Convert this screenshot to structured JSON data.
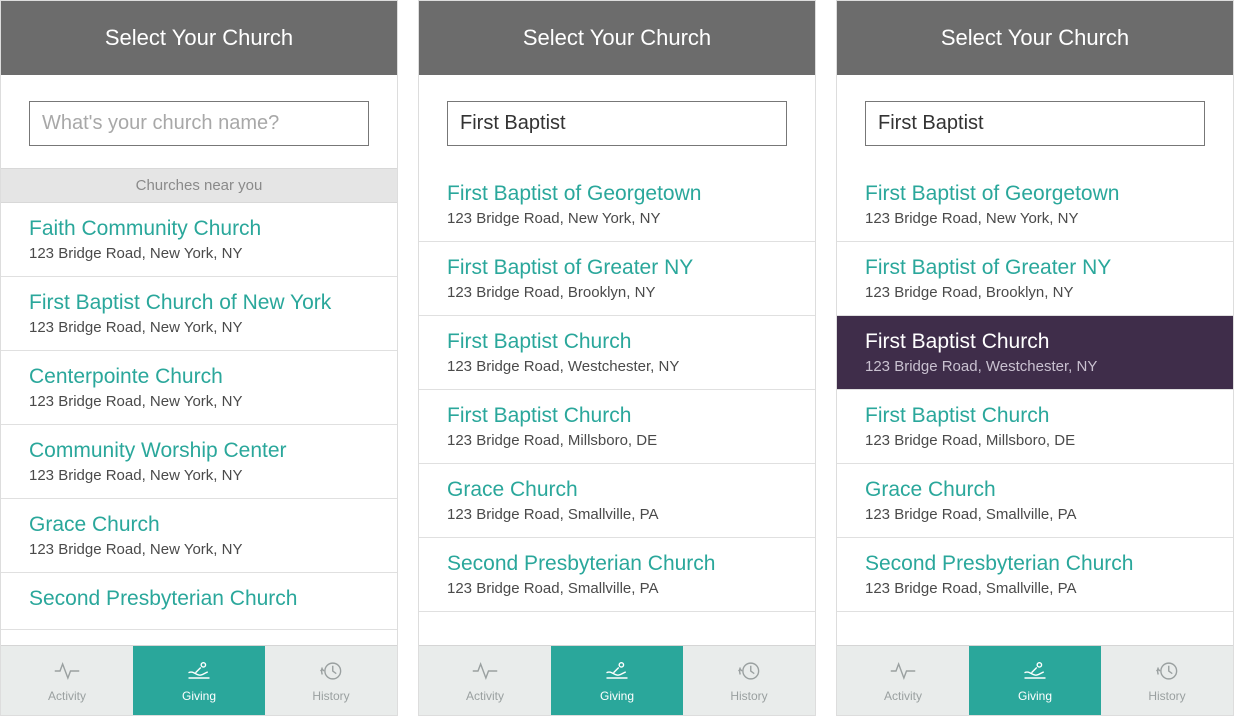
{
  "header_title": "Select Your Church",
  "search_placeholder": "What's your church name?",
  "section_near_label": "Churches near you",
  "colors": {
    "accent": "#2aa79b",
    "header": "#6c6c6c",
    "selected": "#3f2d4a"
  },
  "tabs": [
    {
      "id": "activity",
      "label": "Activity",
      "active": false
    },
    {
      "id": "giving",
      "label": "Giving",
      "active": true
    },
    {
      "id": "history",
      "label": "History",
      "active": false
    }
  ],
  "screens": [
    {
      "search_value": "",
      "show_section_label": true,
      "churches": [
        {
          "name": "Faith Community Church",
          "addr": "123 Bridge Road, New York, NY"
        },
        {
          "name": "First Baptist Church of New York",
          "addr": "123 Bridge Road, New York, NY"
        },
        {
          "name": "Centerpointe Church",
          "addr": "123 Bridge Road, New York, NY"
        },
        {
          "name": "Community Worship Center",
          "addr": "123 Bridge Road, New York, NY"
        },
        {
          "name": "Grace Church",
          "addr": "123 Bridge Road, New York, NY"
        },
        {
          "name": "Second Presbyterian Church",
          "addr": ""
        }
      ],
      "selected_index": -1,
      "caret": false
    },
    {
      "search_value": "First Baptist",
      "show_section_label": false,
      "churches": [
        {
          "name": "First Baptist of Georgetown",
          "addr": "123 Bridge Road, New York, NY"
        },
        {
          "name": "First Baptist of Greater NY",
          "addr": "123 Bridge Road, Brooklyn, NY"
        },
        {
          "name": "First Baptist Church",
          "addr": "123 Bridge Road, Westchester, NY"
        },
        {
          "name": "First Baptist Church",
          "addr": "123 Bridge Road, Millsboro, DE"
        },
        {
          "name": "Grace Church",
          "addr": "123 Bridge Road, Smallville, PA"
        },
        {
          "name": "Second Presbyterian Church",
          "addr": "123 Bridge Road, Smallville, PA"
        }
      ],
      "selected_index": -1,
      "caret": true
    },
    {
      "search_value": "First Baptist",
      "show_section_label": false,
      "churches": [
        {
          "name": "First Baptist of Georgetown",
          "addr": "123 Bridge Road, New York, NY"
        },
        {
          "name": "First Baptist of Greater NY",
          "addr": "123 Bridge Road, Brooklyn, NY"
        },
        {
          "name": "First Baptist Church",
          "addr": "123 Bridge Road, Westchester, NY"
        },
        {
          "name": "First Baptist Church",
          "addr": "123 Bridge Road, Millsboro, DE"
        },
        {
          "name": "Grace Church",
          "addr": "123 Bridge Road, Smallville, PA"
        },
        {
          "name": "Second Presbyterian Church",
          "addr": "123 Bridge Road, Smallville, PA"
        }
      ],
      "selected_index": 2,
      "caret": false
    }
  ]
}
